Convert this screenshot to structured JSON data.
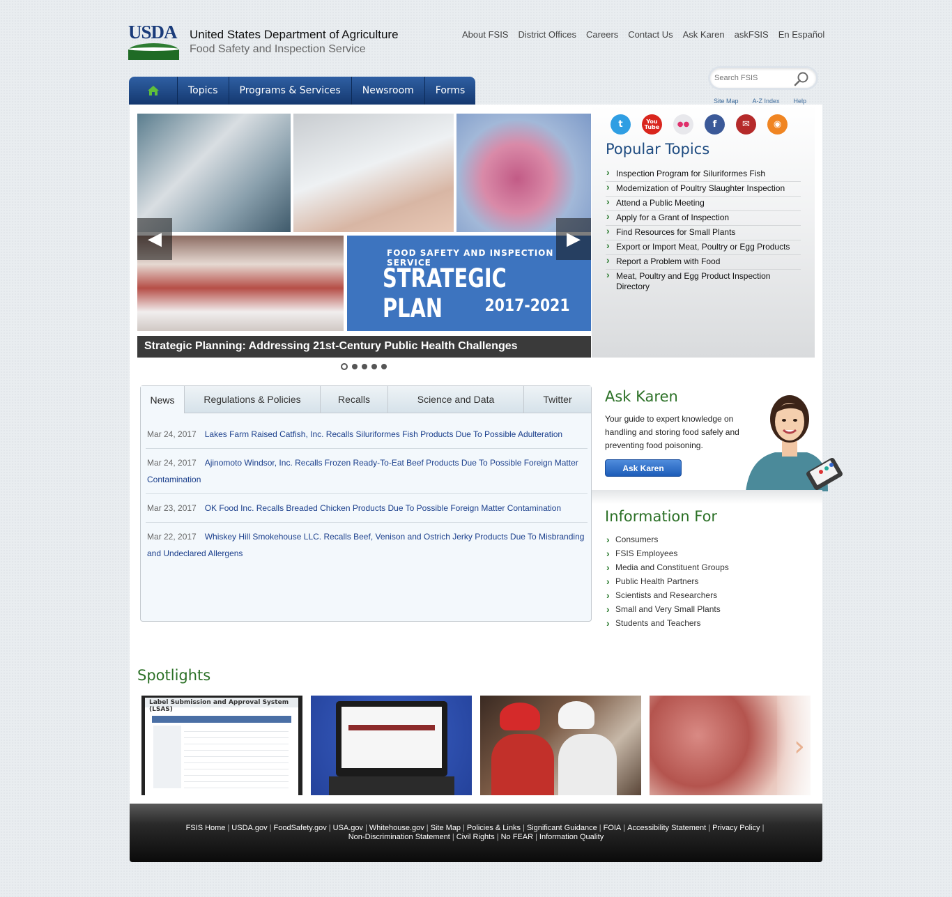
{
  "header": {
    "logo_text": "USDA",
    "agency_name": "United States Department of Agriculture",
    "agency_sub": "Food Safety and Inspection Service",
    "utility_links": [
      "About FSIS",
      "District Offices",
      "Careers",
      "Contact Us",
      "Ask Karen",
      "askFSIS",
      "En Español"
    ],
    "search_placeholder": "Search FSIS",
    "search_links": [
      "Site Map",
      "A-Z Index",
      "Help"
    ]
  },
  "nav": {
    "home_icon": "home-icon",
    "items": [
      "Topics",
      "Programs & Services",
      "Newsroom",
      "Forms"
    ]
  },
  "slideshow": {
    "slide_kicker": "FOOD SAFETY AND INSPECTION SERVICE",
    "slide_title": "STRATEGIC PLAN",
    "slide_years": "2017-2021",
    "caption": "Strategic Planning: Addressing 21st-Century Public Health Challenges",
    "prev_label": "◀",
    "next_label": "▶",
    "slide_count": 5,
    "active_slide": 1
  },
  "social": [
    {
      "name": "twitter-icon",
      "glyph": "t",
      "color": "#2f9ee3"
    },
    {
      "name": "youtube-icon",
      "glyph": "You Tube",
      "color": "#d9251d"
    },
    {
      "name": "flickr-icon",
      "glyph": "●●",
      "color": "#e8e8ec"
    },
    {
      "name": "facebook-icon",
      "glyph": "f",
      "color": "#3b5998"
    },
    {
      "name": "email-icon",
      "glyph": "✉",
      "color": "#b52a2a"
    },
    {
      "name": "rss-icon",
      "glyph": "◉",
      "color": "#f08522"
    }
  ],
  "popular_topics": {
    "title": "Popular Topics",
    "items": [
      "Inspection Program for Siluriformes Fish",
      "Modernization of Poultry Slaughter Inspection",
      "Attend a Public Meeting",
      "Apply for a Grant of Inspection",
      "Find Resources for Small Plants",
      "Export or Import Meat, Poultry or Egg Products",
      "Report a Problem with Food",
      "Meat, Poultry and Egg Product Inspection Directory"
    ]
  },
  "tabs": {
    "labels": [
      "News",
      "Regulations & Policies",
      "Recalls",
      "Science and Data",
      "Twitter"
    ],
    "active": 0,
    "news": [
      {
        "date": "Mar 24, 2017",
        "title": "Lakes Farm Raised Catfish, Inc. Recalls Siluriformes Fish Products Due To Possible Adulteration"
      },
      {
        "date": "Mar 24, 2017",
        "title": "Ajinomoto Windsor, Inc. Recalls Frozen Ready-To-Eat Beef Products Due To Possible Foreign Matter Contamination"
      },
      {
        "date": "Mar 23, 2017",
        "title": "OK Food Inc. Recalls Breaded Chicken Products Due To Possible Foreign Matter Contamination"
      },
      {
        "date": "Mar 22, 2017",
        "title": "Whiskey Hill Smokehouse LLC. Recalls Beef, Venison and Ostrich Jerky Products Due To Misbranding and Undeclared Allergens"
      }
    ]
  },
  "ask_karen": {
    "title": "Ask Karen",
    "description": "Your guide to expert knowledge on handling and storing food safely and preventing food poisoning.",
    "button": "Ask Karen"
  },
  "info_for": {
    "title": "Information For",
    "items": [
      "Consumers",
      "FSIS Employees",
      "Media and Constituent Groups",
      "Public Health Partners",
      "Scientists and Researchers",
      "Small and Very Small Plants",
      "Students and Teachers"
    ]
  },
  "spotlights": {
    "title": "Spotlights",
    "lsas_header": "Label Submission and Approval System (LSAS)",
    "next_label": "›"
  },
  "footer": {
    "row1": [
      "FSIS Home",
      "USDA.gov",
      "FoodSafety.gov",
      "USA.gov",
      "Whitehouse.gov",
      "Site Map",
      "Policies & Links",
      "Significant Guidance",
      "FOIA",
      "Accessibility Statement",
      "Privacy Policy"
    ],
    "row2": [
      "Non-Discrimination Statement",
      "Civil Rights",
      "No FEAR",
      "Information Quality"
    ]
  }
}
